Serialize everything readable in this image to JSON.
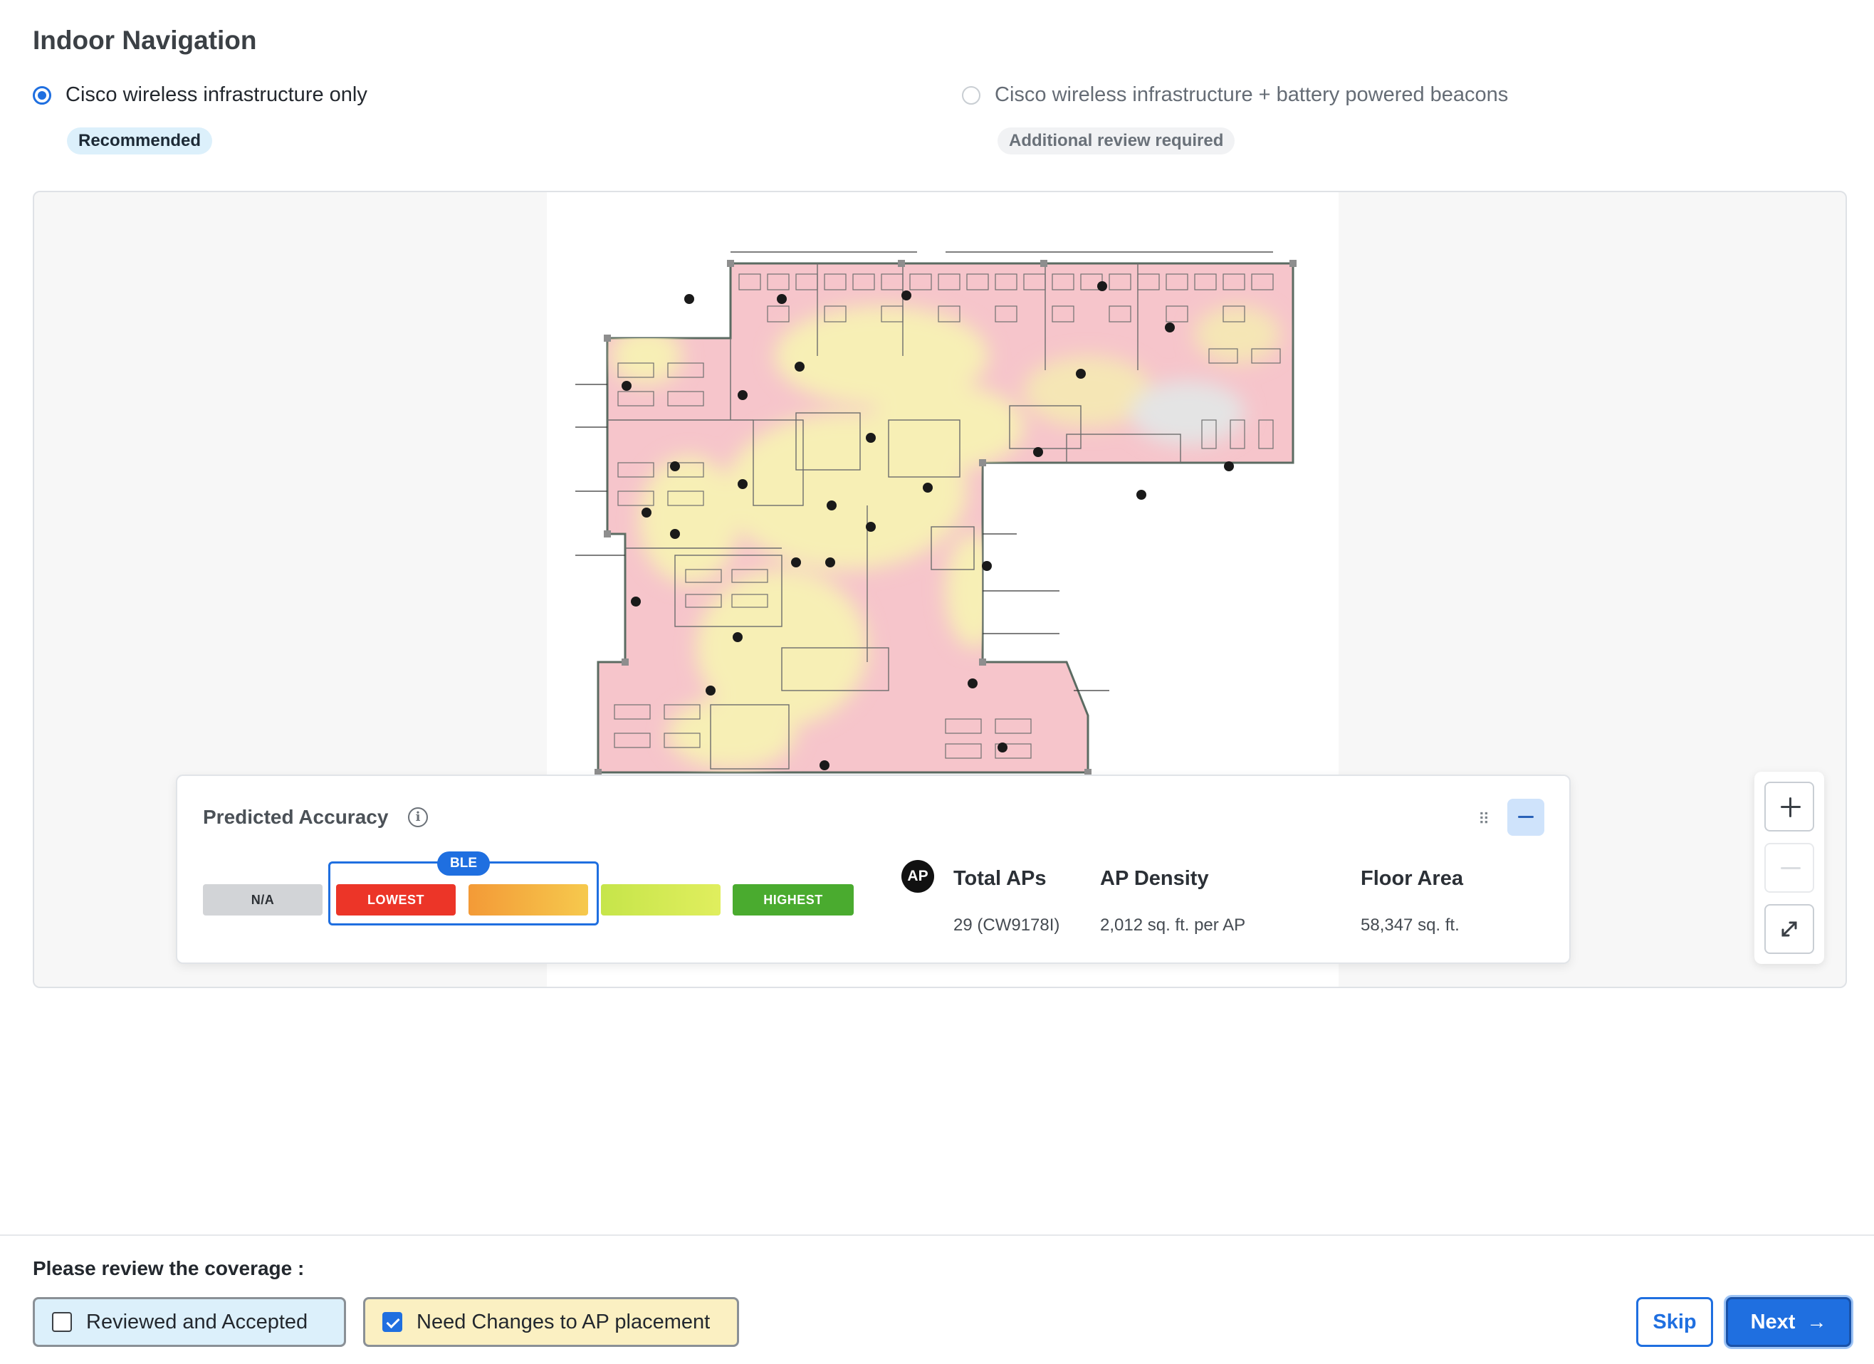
{
  "page": {
    "title": "Indoor Navigation"
  },
  "options": {
    "a": {
      "label": "Cisco wireless infrastructure only",
      "badge": "Recommended",
      "selected": true
    },
    "b": {
      "label": "Cisco wireless infrastructure + battery powered beacons",
      "badge": "Additional review required",
      "selected": false
    }
  },
  "accuracy": {
    "title": "Predicted Accuracy",
    "info_icon": "info-icon",
    "legend": {
      "na": "N/A",
      "lowest": "LOWEST",
      "highest": "HIGHEST",
      "ble_tag": "BLE"
    },
    "ap_badge": "AP",
    "stats": {
      "total_aps_label": "Total APs",
      "total_aps_value": "29 (CW9178I)",
      "density_label": "AP Density",
      "density_value": "2,012 sq. ft. per AP",
      "area_label": "Floor Area",
      "area_value": "58,347 sq. ft."
    },
    "colors": {
      "lowest": "#ec3528",
      "mid": "#f39a37",
      "high": "#c6e54a",
      "highest": "#4aab2f",
      "na": "#d2d4d7"
    }
  },
  "zoom": {
    "in_icon": "plus-icon",
    "out_icon": "minus-icon",
    "fit_icon": "expand-icon"
  },
  "footer": {
    "review_label": "Please review the coverage :",
    "reviewed": {
      "label": "Reviewed and Accepted",
      "checked": false
    },
    "changes": {
      "label": "Need Changes to AP placement",
      "checked": true
    },
    "skip": "Skip",
    "next": "Next",
    "next_icon": "arrow-right-icon",
    "accent": "#1f6fe0"
  }
}
